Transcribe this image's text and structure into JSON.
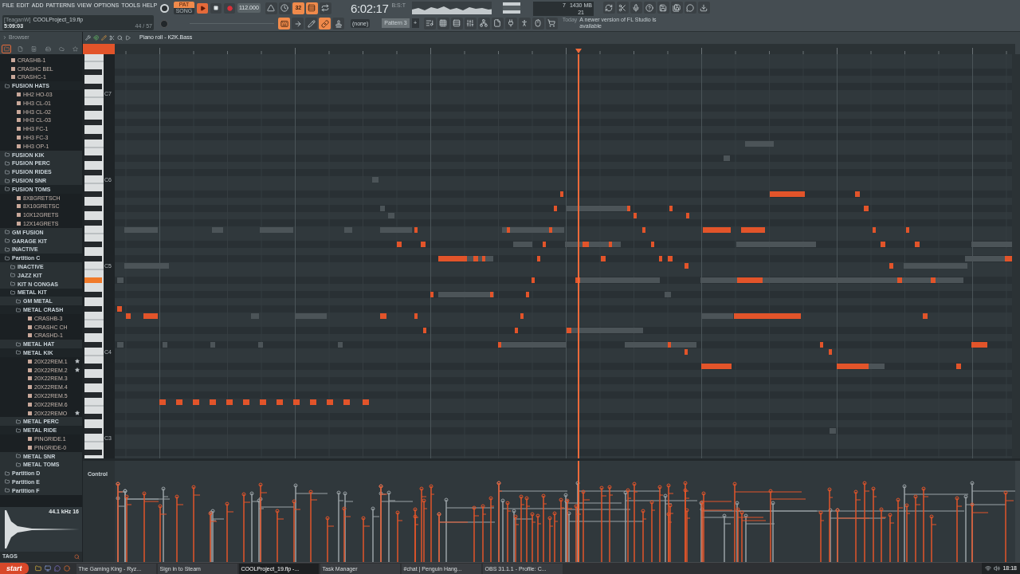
{
  "menu": [
    "FILE",
    "EDIT",
    "ADD",
    "PATTERNS",
    "VIEW",
    "OPTIONS",
    "TOOLS",
    "HELP"
  ],
  "project": {
    "user": "[TeaganW]",
    "file": "COOLProject_19.flp",
    "time": "5:09:03",
    "count": "44 / 57"
  },
  "mode": [
    {
      "label": "PAT",
      "selected": true
    },
    {
      "label": "SONG",
      "selected": false
    }
  ],
  "tempo": "112.000",
  "toggles_top": [
    {
      "kind": "metronome",
      "on": false
    },
    {
      "kind": "wait",
      "on": false
    },
    {
      "kind": "countdown",
      "on": true,
      "label": "32"
    },
    {
      "kind": "overdub",
      "on": true
    },
    {
      "kind": "loop",
      "on": false
    }
  ],
  "toggles_bottom": [
    {
      "kind": "keyboard",
      "on": true
    },
    {
      "kind": "arrow",
      "on": false
    },
    {
      "kind": "pencil",
      "on": false
    },
    {
      "kind": "link",
      "on": true
    },
    {
      "kind": "stamp",
      "on": false
    }
  ],
  "time": "6:02:17",
  "time_unit": "B:S:T",
  "cpu": {
    "voices": "7",
    "memory": "1430 MB",
    "polyphony": "21"
  },
  "system_buttons": [
    {
      "kind": "refresh"
    },
    {
      "kind": "cut"
    },
    {
      "kind": "mic"
    },
    {
      "kind": "help"
    },
    {
      "kind": "save"
    },
    {
      "kind": "save-new"
    },
    {
      "kind": "chat"
    },
    {
      "kind": "download"
    }
  ],
  "snap": "(none)",
  "pattern": "Pattern 3",
  "pattern_add": "+",
  "window_buttons": [
    {
      "kind": "playlist"
    },
    {
      "kind": "channels"
    },
    {
      "kind": "rack"
    },
    {
      "kind": "mixer"
    },
    {
      "kind": "tree"
    },
    {
      "kind": "file"
    },
    {
      "kind": "plugin"
    },
    {
      "kind": "person"
    },
    {
      "kind": "mouse"
    },
    {
      "kind": "cart"
    }
  ],
  "news": {
    "date": "Today",
    "text": "A newer version of FL Studio is available"
  },
  "browser": {
    "title": "Browser",
    "tabs": [
      {
        "kind": "all",
        "selected": true
      },
      {
        "kind": "file",
        "selected": false
      },
      {
        "kind": "speaker",
        "selected": false
      },
      {
        "kind": "disk",
        "selected": false
      },
      {
        "kind": "cloud",
        "selected": false
      },
      {
        "kind": "star",
        "selected": false
      }
    ],
    "tree": [
      {
        "kind": "file",
        "label": "CRASHB-1",
        "starred": false
      },
      {
        "kind": "file",
        "label": "CRASHC BEL",
        "starred": false
      },
      {
        "kind": "file",
        "label": "CRASHC-1",
        "starred": false
      },
      {
        "kind": "folder",
        "label": "FUSION HATS",
        "expanded": true,
        "children": [
          {
            "kind": "file",
            "label": "HH2 HO-03",
            "starred": false
          },
          {
            "kind": "file",
            "label": "HH3 CL-01",
            "starred": false
          },
          {
            "kind": "file",
            "label": "HH3 CL-02",
            "starred": false
          },
          {
            "kind": "file",
            "label": "HH3 CL-03",
            "starred": false
          },
          {
            "kind": "file",
            "label": "HH3 FC-1",
            "starred": false
          },
          {
            "kind": "file",
            "label": "HH3 FC-3",
            "starred": false
          },
          {
            "kind": "file",
            "label": "HH3 OP-1",
            "starred": false
          }
        ]
      },
      {
        "kind": "folder",
        "label": "FUSION KIK",
        "expanded": false
      },
      {
        "kind": "folder",
        "label": "FUSION PERC",
        "expanded": false
      },
      {
        "kind": "folder",
        "label": "FUSION RIDES",
        "expanded": false
      },
      {
        "kind": "folder",
        "label": "FUSION SNR",
        "expanded": false
      },
      {
        "kind": "folder",
        "label": "FUSION TOMS",
        "expanded": true,
        "children": [
          {
            "kind": "file",
            "label": "8X8GRETSCH",
            "starred": false
          },
          {
            "kind": "file",
            "label": "8X10GRETSC",
            "starred": false
          },
          {
            "kind": "file",
            "label": "10X12GRETS",
            "starred": false
          },
          {
            "kind": "file",
            "label": "12X14GRETS",
            "starred": false
          }
        ]
      },
      {
        "kind": "folder",
        "label": "GM FUSION",
        "expanded": false
      },
      {
        "kind": "folder",
        "label": "GARAGE KIT",
        "expanded": false
      },
      {
        "kind": "folder",
        "label": "INACTIVE",
        "expanded": false
      },
      {
        "kind": "folder",
        "label": "Partition C",
        "expanded": true,
        "children": [
          {
            "kind": "folder",
            "label": "INACTIVE",
            "expanded": false
          },
          {
            "kind": "folder",
            "label": "JAZZ KIT",
            "expanded": false
          },
          {
            "kind": "folder",
            "label": "KIT N CONGAS",
            "expanded": false
          },
          {
            "kind": "folder",
            "label": "METAL KIT",
            "expanded": true,
            "children": [
              {
                "kind": "folder",
                "label": "GM METAL",
                "expanded": false
              },
              {
                "kind": "folder",
                "label": "METAL CRASH",
                "expanded": true,
                "children": [
                  {
                    "kind": "file",
                    "label": "CRASHB-3",
                    "starred": false
                  },
                  {
                    "kind": "file",
                    "label": "CRASHC  CH",
                    "starred": false
                  },
                  {
                    "kind": "file",
                    "label": "CRASHD-1",
                    "starred": false
                  }
                ]
              },
              {
                "kind": "folder",
                "label": "METAL HAT",
                "expanded": false
              },
              {
                "kind": "folder",
                "label": "METAL KIK",
                "expanded": true,
                "children": [
                  {
                    "kind": "file",
                    "label": "20X22REM.1",
                    "starred": true
                  },
                  {
                    "kind": "file",
                    "label": "20X22REM.2",
                    "starred": true
                  },
                  {
                    "kind": "file",
                    "label": "20X22REM.3",
                    "starred": false
                  },
                  {
                    "kind": "file",
                    "label": "20X22REM.4",
                    "starred": false
                  },
                  {
                    "kind": "file",
                    "label": "20X22REM.5",
                    "starred": false
                  },
                  {
                    "kind": "file",
                    "label": "20X22REM.6",
                    "starred": false
                  },
                  {
                    "kind": "file",
                    "label": "20X22REMO",
                    "starred": true
                  }
                ]
              },
              {
                "kind": "folder",
                "label": "METAL PERC",
                "expanded": false
              },
              {
                "kind": "folder",
                "label": "METAL RIDE",
                "expanded": true,
                "children": [
                  {
                    "kind": "file",
                    "label": "PINGRIDE.1",
                    "starred": false
                  },
                  {
                    "kind": "file",
                    "label": "PINGRIDE-0",
                    "starred": false
                  }
                ]
              },
              {
                "kind": "folder",
                "label": "METAL SNR",
                "expanded": false
              },
              {
                "kind": "folder",
                "label": "METAL TOMS",
                "expanded": false
              }
            ]
          }
        ]
      },
      {
        "kind": "folder",
        "label": "Partition D",
        "expanded": false
      },
      {
        "kind": "folder",
        "label": "Partition E",
        "expanded": false
      },
      {
        "kind": "folder",
        "label": "Partition F",
        "expanded": false
      }
    ],
    "sample_info": "44.1 kHz 16",
    "tags": "TAGS"
  },
  "piano_roll": {
    "title": "Piano roll - K2K.Bass",
    "key_labels": [
      "C7",
      "C6",
      "C5",
      "C4",
      "C3"
    ],
    "control_label": "Control"
  },
  "taskbar": {
    "start": "start",
    "tasks": [
      {
        "label": "The Gaming King - Ryz...",
        "selected": false
      },
      {
        "label": "Sign in to Steam",
        "selected": false
      },
      {
        "label": "COOLProject_19.flp -...",
        "selected": true
      },
      {
        "label": "Task Manager",
        "selected": false
      },
      {
        "label": "#chat | Penguin Hang...",
        "selected": false
      },
      {
        "label": "OBS 31.1.1 - Profile: C...",
        "selected": false
      }
    ],
    "clock": "18:18"
  }
}
